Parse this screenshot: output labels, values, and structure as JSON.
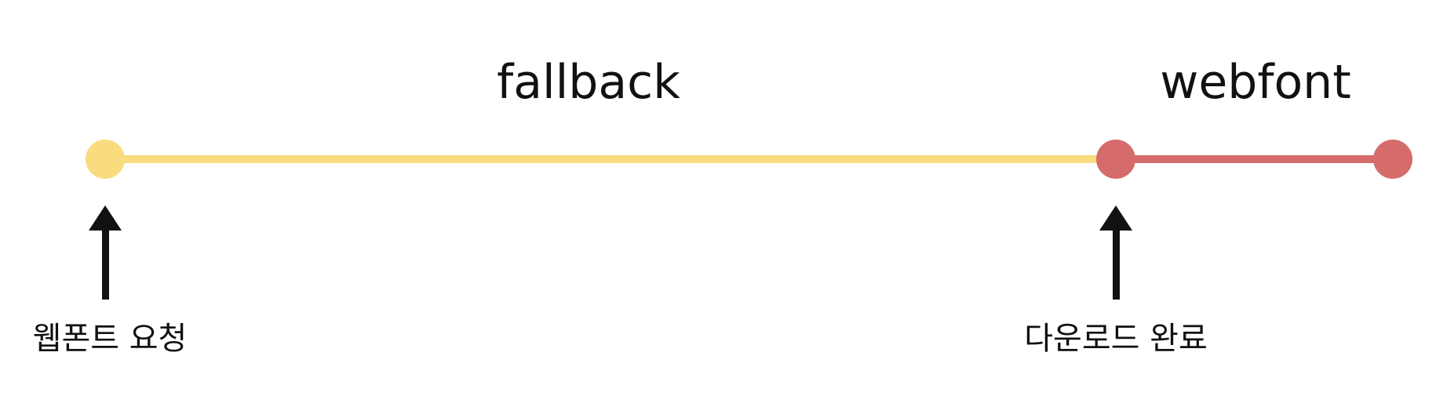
{
  "colors": {
    "fallback": "#f9dc7e",
    "webfont": "#d56b6a",
    "arrow": "#111111",
    "text": "#111111"
  },
  "phases": {
    "fallback": "fallback",
    "webfont": "webfont"
  },
  "events": {
    "request": "웹폰트 요청",
    "download_complete": "다운로드 완료"
  }
}
